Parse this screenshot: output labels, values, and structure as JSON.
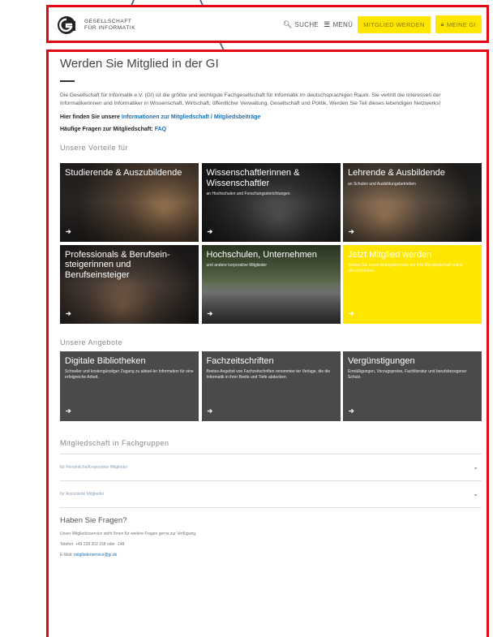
{
  "header": {
    "logo_text_line1": "GESELLSCHAFT",
    "logo_text_line2": "FÜR INFORMATIK",
    "nav": {
      "search_label": "SUCHE",
      "menu_label": "MENÜ",
      "join_label": "MITGLIED WERDEN",
      "mygi_label": "MEINE GI"
    }
  },
  "main": {
    "title": "Werden Sie Mitglied in der GI",
    "intro": "Die Gesellschaft für Informatik e.V. (GI) ist die größte und wichtigste Fachgesellschaft für Informatik im deutschsprachigen Raum. Sie vertritt die Interessen der Informatikerinnen und Informatiker in Wissenschaft, Wirtschaft, öffentlicher Verwaltung, Gesellschaft und Politik. Werden Sie Teil dieses lebendigen Netzwerks!",
    "info_prefix": "Hier finden Sie unsere",
    "info_link": "Informationen zur Mitgliedschaft / Mitgliedsbeiträge",
    "faq_prefix": "Häufige Fragen zur Mitgliedschaft:",
    "faq_link": "FAQ",
    "benefits_heading": "Unsere Vorteile für",
    "benefits": [
      {
        "title": "Studierende & Auszubildende",
        "sub": "",
        "arrow": "➔"
      },
      {
        "title": "Wissenschaftlerinnen & Wissenschaftler",
        "sub": "an Hochschulen und Forschungseinrichtungen",
        "arrow": "➔"
      },
      {
        "title": "Lehrende & Ausbildende",
        "sub": "an Schulen und Ausbildungsbetrieben",
        "arrow": "➔"
      },
      {
        "title": "Professionals & Berufsein-steigerinnen und Berufseinsteiger",
        "sub": "",
        "arrow": "➔"
      },
      {
        "title": "Hochschulen, Unternehmen",
        "sub": "und andere korporative Mitglieder",
        "arrow": "➔"
      },
      {
        "title": "Jetzt Mitglied werden",
        "sub": "Nutzen Sie unser Antragsformular um Ihre Mit-gliedschaft online abzuschließen.",
        "arrow": "➔"
      }
    ],
    "offers_heading": "Unsere Angebote",
    "offers": [
      {
        "title": "Digitale Bibliotheken",
        "sub": "Schneller und kostengünstiger Zugang zu aktuel-ler Information für eine erfolgreiche Arbeit.",
        "arrow": "➔"
      },
      {
        "title": "Fachzeitschriften",
        "sub": "Breites Angebot von Fachzeitschriften renommier-ter Verlage, die die Informatik in ihrer Breite und Tiefe abdecken.",
        "arrow": "➔"
      },
      {
        "title": "Vergünstigungen",
        "sub": "Ermäßigungen, Vorzugspreise, Fachliteratur und berufsbezogener Schutz.",
        "arrow": "➔"
      }
    ],
    "groups_heading": "Mitgliedschaft in Fachgruppen",
    "accordion": [
      {
        "label": "für Persönliche/Korporative Mitglieder"
      },
      {
        "label": "für Assoziierte Mitglieder"
      }
    ],
    "contact": {
      "title": "Haben Sie Fragen?",
      "line1": "Unser Mitgliederservice steht Ihnen für weitere Fragen gerne zur Verfügung.",
      "phone": "Telefon: +49 228 302 158 oder -148",
      "email_prefix": "E-Mail:",
      "email": "mitgliederservice@gi.de"
    }
  },
  "colors": {
    "annotation": "#e30613",
    "pointer": "#4a5f7a",
    "accent_yellow": "#ffe600",
    "link_blue": "#1a6fb5",
    "tile_dark": "#4a4a4a"
  }
}
